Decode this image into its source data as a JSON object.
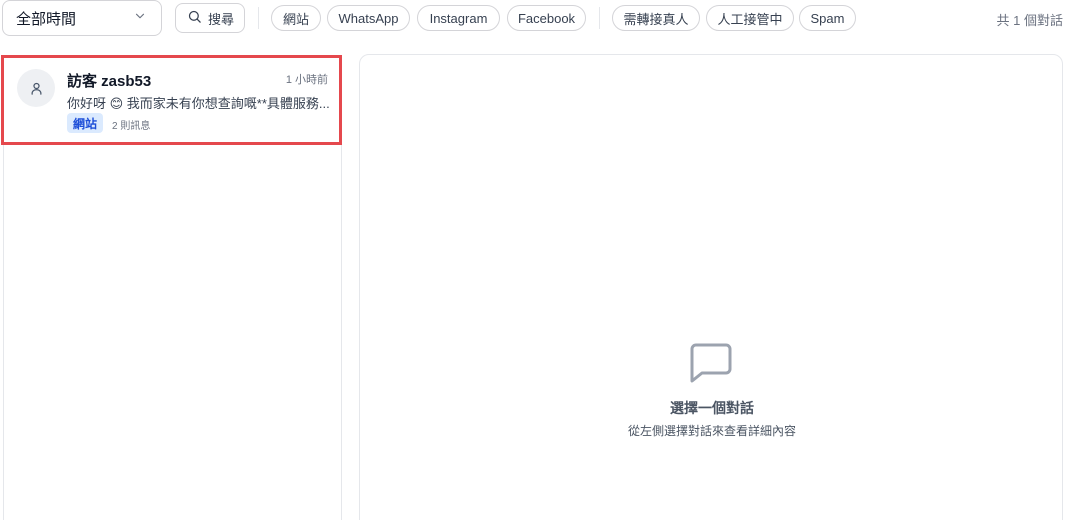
{
  "toolbar": {
    "time_filter": "全部時間",
    "search_label": "搜尋",
    "channel_filters": [
      "網站",
      "WhatsApp",
      "Instagram",
      "Facebook"
    ],
    "status_filters": [
      "需轉接真人",
      "人工接管中",
      "Spam"
    ],
    "total_count": "共 1 個對話"
  },
  "conversations": [
    {
      "name": "訪客 zasb53",
      "time": "1 小時前",
      "preview": "你好呀 😊 我而家未有你想查詢嘅**具體服務...",
      "channel": "網站",
      "message_count": "2 則訊息"
    }
  ],
  "detail": {
    "empty_title": "選擇一個對話",
    "empty_subtitle": "從左側選擇對話來查看詳細內容"
  },
  "colors": {
    "selected_outline": "#e5484d",
    "channel_tag_bg": "#dbeafe",
    "channel_tag_text": "#1d4ed8"
  }
}
